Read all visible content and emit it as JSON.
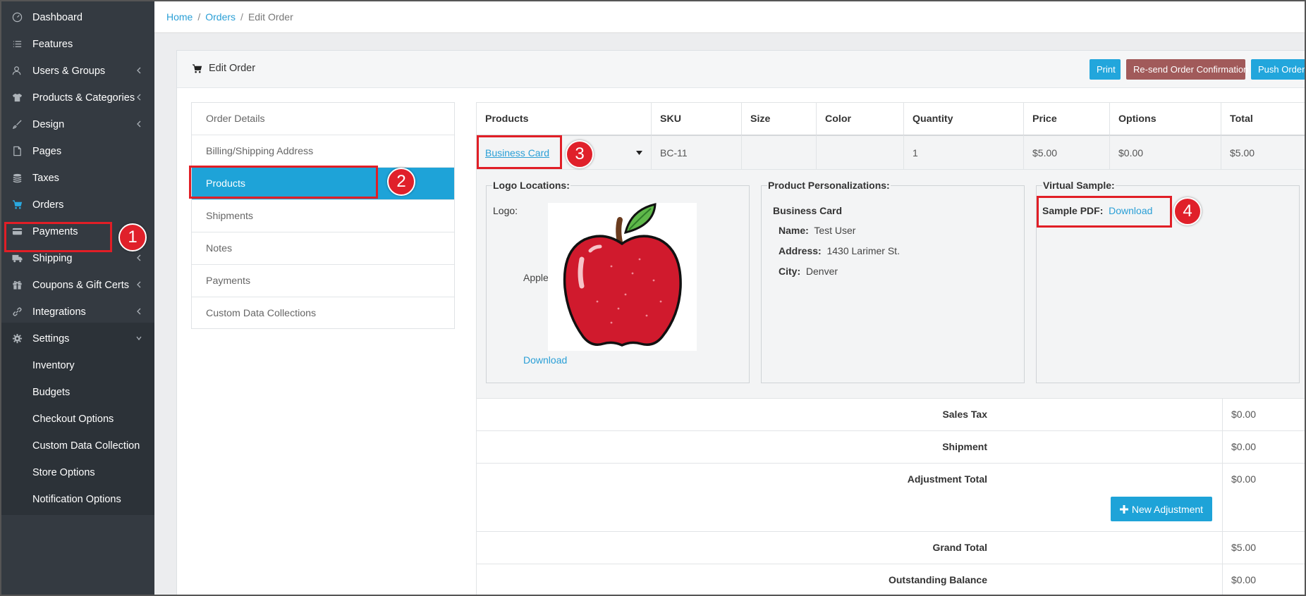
{
  "sidebar": {
    "items": [
      {
        "label": "Dashboard",
        "icon": "dashboard-icon"
      },
      {
        "label": "Features",
        "icon": "list-icon"
      },
      {
        "label": "Users & Groups",
        "icon": "users-icon"
      },
      {
        "label": "Products & Categories",
        "icon": "shirt-icon"
      },
      {
        "label": "Design",
        "icon": "brush-icon"
      },
      {
        "label": "Pages",
        "icon": "file-icon"
      },
      {
        "label": "Taxes",
        "icon": "coins-icon"
      },
      {
        "label": "Orders",
        "icon": "cart-icon"
      },
      {
        "label": "Payments",
        "icon": "credit-card-icon"
      },
      {
        "label": "Shipping",
        "icon": "truck-icon"
      },
      {
        "label": "Coupons & Gift Certs",
        "icon": "gift-icon"
      },
      {
        "label": "Integrations",
        "icon": "link-icon"
      },
      {
        "label": "Settings",
        "icon": "gear-icon"
      },
      {
        "label": "Inventory"
      },
      {
        "label": "Budgets"
      },
      {
        "label": "Checkout Options"
      },
      {
        "label": "Custom Data Collection"
      },
      {
        "label": "Store Options"
      },
      {
        "label": "Notification Options"
      }
    ]
  },
  "breadcrumb": {
    "home": "Home",
    "orders": "Orders",
    "current": "Edit Order",
    "separator": "/"
  },
  "card": {
    "title": "Edit Order",
    "buttons": {
      "print": "Print",
      "resend": "Re-send Order Confirmation",
      "push": "Push Order"
    }
  },
  "tabs": [
    "Order Details",
    "Billing/Shipping Address",
    "Products",
    "Shipments",
    "Notes",
    "Payments",
    "Custom Data Collections"
  ],
  "products_table": {
    "headers": [
      "Products",
      "SKU",
      "Size",
      "Color",
      "Quantity",
      "Price",
      "Options",
      "Total"
    ],
    "row": {
      "product": "Business Card",
      "sku": "BC-11",
      "size": "",
      "color": "",
      "quantity": "1",
      "price": "$5.00",
      "options": "$0.00",
      "total": "$5.00"
    }
  },
  "logo_locations": {
    "legend": "Logo Locations:",
    "logo_label": "Logo:",
    "logo_name": "Apple",
    "download": "Download"
  },
  "personalizations": {
    "legend": "Product Personalizations:",
    "product": "Business Card",
    "fields": [
      {
        "label": "Name:",
        "value": "Test User"
      },
      {
        "label": "Address:",
        "value": "1430 Larimer St."
      },
      {
        "label": "City:",
        "value": "Denver"
      }
    ]
  },
  "virtual_sample": {
    "legend": "Virtual Sample:",
    "label": "Sample PDF:",
    "download": "Download"
  },
  "totals": {
    "sales_tax": {
      "label": "Sales Tax",
      "value": "$0.00"
    },
    "shipment": {
      "label": "Shipment",
      "value": "$0.00"
    },
    "adjustment": {
      "label": "Adjustment Total",
      "value": "$0.00"
    },
    "grand": {
      "label": "Grand Total",
      "value": "$5.00"
    },
    "outstanding": {
      "label": "Outstanding Balance",
      "value": "$0.00"
    },
    "new_adjustment": "New Adjustment"
  },
  "annotations": [
    "1",
    "2",
    "3",
    "4"
  ],
  "colors": {
    "sidebar": "#343a41",
    "accent": "#1ea3d8",
    "resend": "#a05555",
    "highlight": "#e11e26"
  }
}
